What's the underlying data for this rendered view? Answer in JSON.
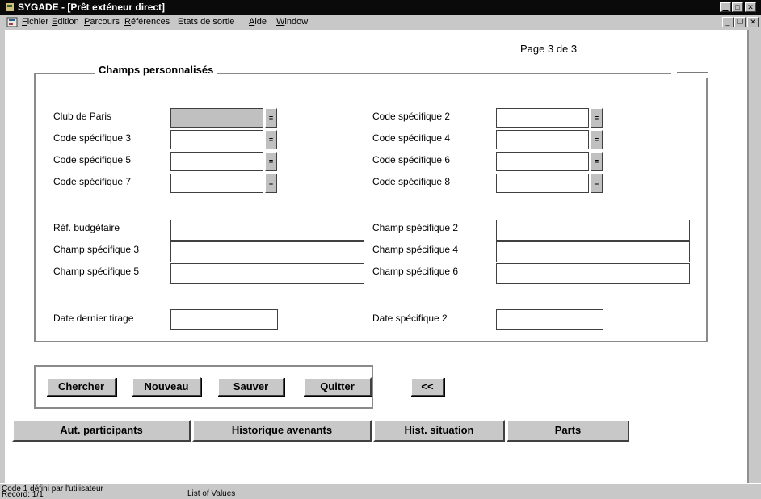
{
  "window": {
    "title": "SYGADE - [Prêt exténeur direct]",
    "controls": {
      "minimize": "▁",
      "maximize": "□",
      "close": "✕"
    },
    "mdi_controls": {
      "minimize": "_",
      "restore": "❐",
      "close": "✕"
    }
  },
  "menu": {
    "items": [
      {
        "first": "F",
        "rest": "ichier"
      },
      {
        "first": "E",
        "rest": "dition"
      },
      {
        "first": "P",
        "rest": "arcours"
      },
      {
        "first": "R",
        "rest": "éférences"
      },
      {
        "first": "",
        "rest": "Etats de sortie"
      },
      {
        "first": "A",
        "rest": "ide"
      },
      {
        "first": "W",
        "rest": "indow"
      }
    ]
  },
  "page_indicator": "Page 3 de 3",
  "group_title": "Champs personnalisés",
  "labels": {
    "club_de_paris": "Club de Paris",
    "code_2": "Code spécifique 2",
    "code_3": "Code spécifique 3",
    "code_4": "Code spécifique 4",
    "code_5": "Code spécifique 5",
    "code_6": "Code spécifique 6",
    "code_7": "Code spécifique 7",
    "code_8": "Code spécifique 8",
    "ref_budgetaire": "Réf. budgétaire",
    "champ_2": "Champ spécifique 2",
    "champ_3": "Champ spécifique 3",
    "champ_4": "Champ spécifique 4",
    "champ_5": "Champ spécifique 5",
    "champ_6": "Champ spécifique 6",
    "date_dernier_tirage": "Date dernier tirage",
    "date_2": "Date spécifique 2"
  },
  "lov_glyph": "=",
  "buttons": {
    "chercher": "Chercher",
    "nouveau": "Nouveau",
    "sauver": "Sauver",
    "quitter": "Quitter",
    "previous_page": "<<"
  },
  "tabs": [
    "Aut. participants",
    "Historique avenants",
    "Hist. situation",
    "Parts"
  ],
  "status": {
    "message": "Code 1 défini par l'utilisateur",
    "record": "Record: 1/1",
    "mode": "List of Values"
  }
}
